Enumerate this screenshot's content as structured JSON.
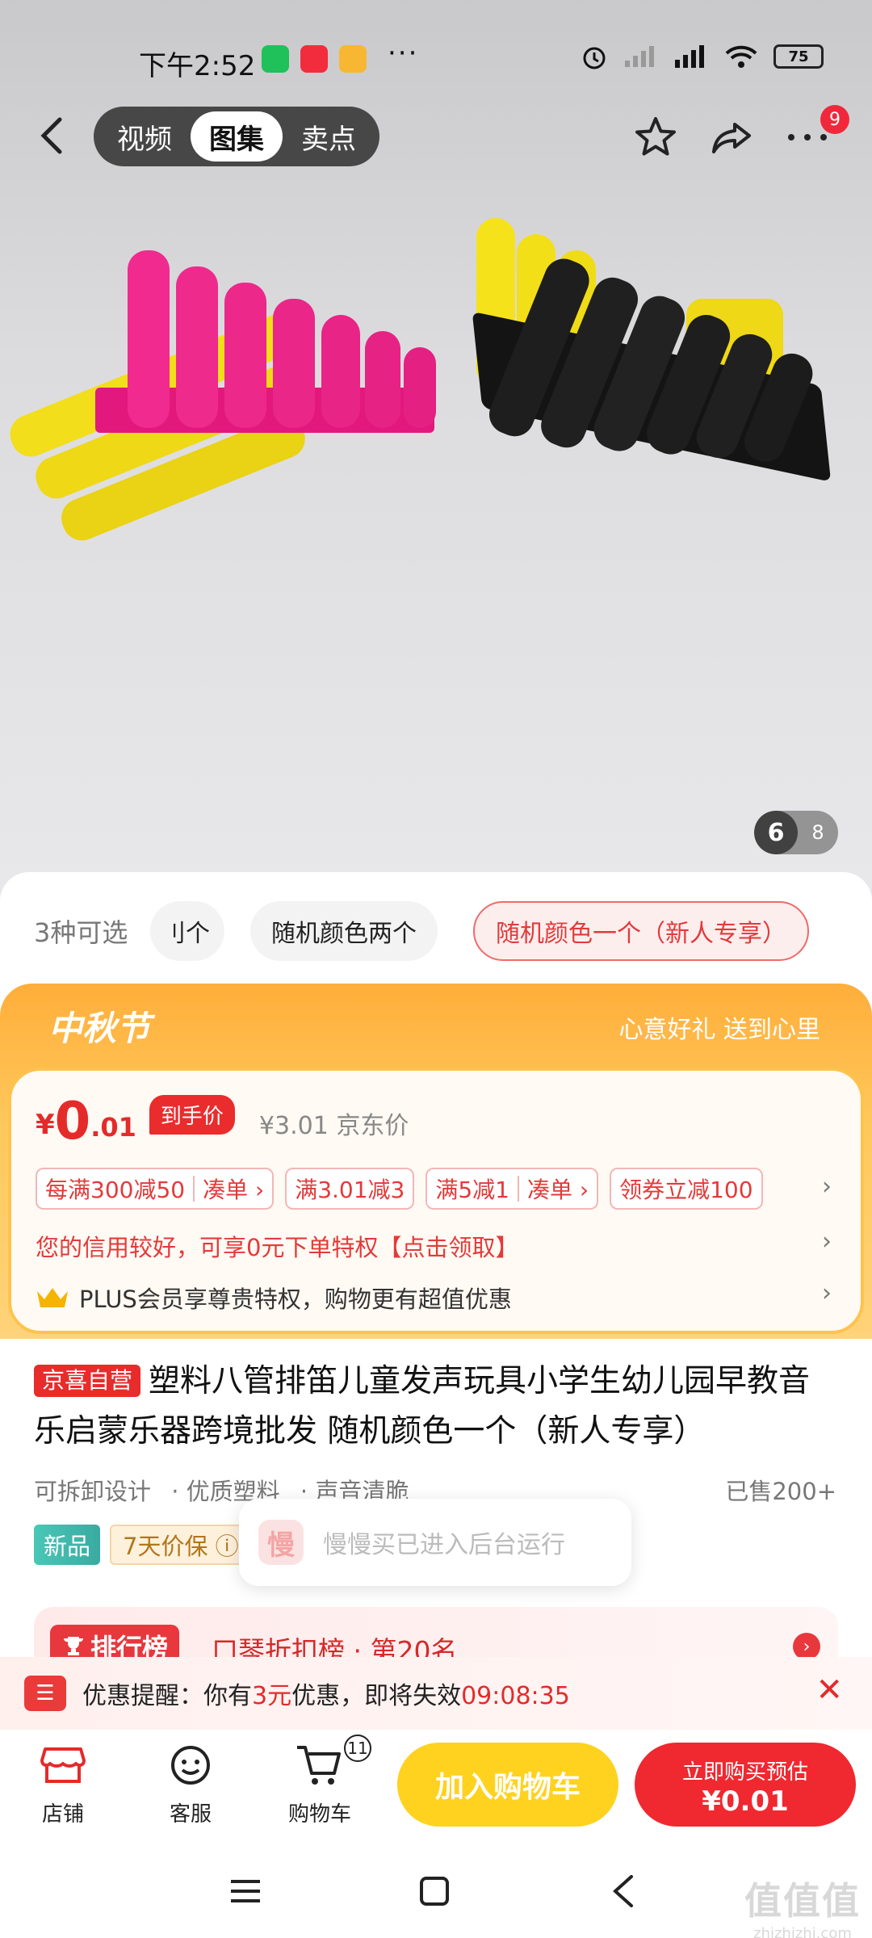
{
  "status_bar": {
    "time": "下午2:52",
    "dots": "···",
    "battery": "75"
  },
  "top_nav": {
    "tabs": [
      "视频",
      "图集",
      "卖点"
    ],
    "active_tab": "图集",
    "more_badge": "9"
  },
  "gallery": {
    "current": "6",
    "total": "8"
  },
  "variants": {
    "count_label": "3种可选",
    "chips": [
      "刂个",
      "随机颜色两个",
      "随机颜色一个（新人专享）"
    ]
  },
  "festival": {
    "title": "中秋节",
    "slogan": "心意好礼 送到心里"
  },
  "price": {
    "yen": "¥",
    "integer": "0",
    "decimal": ".01",
    "tag": "到手价",
    "jd_price": "¥3.01 京东价"
  },
  "coupons": {
    "c1_left": "每满300减50",
    "c1_right": "凑单 ›",
    "c2": "满3.01减3",
    "c3_left": "满5减1",
    "c3_right": "凑单 ›",
    "c4": "领券立减100"
  },
  "credit": "您的信用较好，可享0元下单特权【点击领取】",
  "plus": "PLUS会员享尊贵特权，购物更有超值优惠",
  "chevron": "›",
  "product": {
    "self_tag": "京喜自营",
    "title": "塑料八管排笛儿童发声玩具小学生幼儿园早教音乐启蒙乐器跨境批发 随机颜色一个（新人专享）",
    "features": [
      "可拆卸设计",
      "· 优质塑料",
      "· 声音清脆"
    ],
    "sold": "已售200+",
    "tag_new": "新品",
    "tag_protect": "7天价保 ⓘ"
  },
  "toast": {
    "icon": "慢",
    "text": "慢慢买已进入后台运行"
  },
  "rank": {
    "tag": "排行榜",
    "text": "口琴折扣榜 · 第20名",
    "go": "›"
  },
  "reminder": {
    "prefix": "优惠提醒：你有",
    "amount": "3元",
    "suffix": "优惠，即将失效",
    "time": "09:08:35",
    "close": "✕"
  },
  "actions": {
    "shop": "店铺",
    "service": "客服",
    "cart": "购物车",
    "cart_badge": "11"
  },
  "buttons": {
    "add_cart": "加入购物车",
    "buy_line1": "立即购买预估",
    "buy_line2": "¥0.01"
  },
  "watermark": {
    "big": "值值值",
    "small": "zhizhizhi.com"
  },
  "colors": {
    "brand_red": "#f0282f",
    "cart_yellow": "#ffd21f",
    "festival_orange": "#ffae3a"
  }
}
